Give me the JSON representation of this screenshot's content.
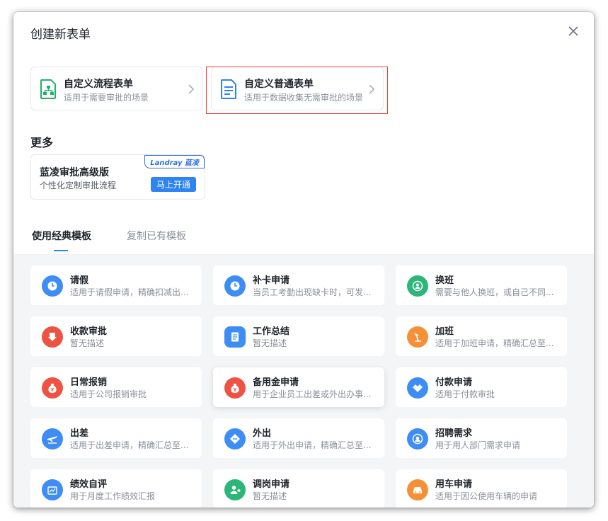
{
  "dialog": {
    "title": "创建新表单"
  },
  "types": [
    {
      "name": "自定义流程表单",
      "desc": "适用于需要审批的场景"
    },
    {
      "name": "自定义普通表单",
      "desc": "适用于数据收集无需审批的场景"
    }
  ],
  "more": {
    "heading": "更多",
    "promo_title": "蓝凌审批高级版",
    "promo_desc": "个性化定制审批流程",
    "brand": "Landray 蓝凌",
    "button": "马上开通"
  },
  "tabs": [
    "使用经典模板",
    "复制已有模板"
  ],
  "templates": [
    {
      "name": "请假",
      "desc": "适用于请假申请，精确扣减出...",
      "color": "#3d8df5",
      "icon": "clock-icon"
    },
    {
      "name": "补卡申请",
      "desc": "当员工考勤出现缺卡时，可发...",
      "color": "#3d8df5",
      "icon": "clock-icon"
    },
    {
      "name": "换班",
      "desc": "需要与他人换班，或自己不同...",
      "color": "#2cb679",
      "icon": "swap-user-icon"
    },
    {
      "name": "收款审批",
      "desc": "暂无描述",
      "color": "#ee5243",
      "icon": "receive-icon"
    },
    {
      "name": "工作总结",
      "desc": "暂无描述",
      "color": "#3d8df5",
      "icon": "document-icon"
    },
    {
      "name": "加班",
      "desc": "适用于加班申请，精确汇总至...",
      "color": "#f59037",
      "icon": "desk-lamp-icon"
    },
    {
      "name": "日常报销",
      "desc": "适用于公司报销审批",
      "color": "#ee5243",
      "icon": "money-bag-icon"
    },
    {
      "name": "备用金申请",
      "desc": "用于企业员工出差或外出办事...",
      "color": "#ee5243",
      "icon": "money-bag-icon"
    },
    {
      "name": "付款申请",
      "desc": "适用于付款审批",
      "color": "#3d8df5",
      "icon": "handshake-icon"
    },
    {
      "name": "出差",
      "desc": "适用于出差申请，精确汇总至...",
      "color": "#3d8df5",
      "icon": "plane-icon"
    },
    {
      "name": "外出",
      "desc": "适用于外出申请，精确汇总至...",
      "color": "#3d8df5",
      "icon": "outing-icon"
    },
    {
      "name": "招聘需求",
      "desc": "用于用人部门需求申请",
      "color": "#3d8df5",
      "icon": "recruit-icon"
    },
    {
      "name": "绩效自评",
      "desc": "用于月度工作绩效汇报",
      "color": "#3d8df5",
      "icon": "chart-icon"
    },
    {
      "name": "调岗申请",
      "desc": "暂无描述",
      "color": "#2cb679",
      "icon": "transfer-user-icon"
    },
    {
      "name": "用车申请",
      "desc": "适用于因公使用车辆的申请",
      "color": "#f59037",
      "icon": "car-icon"
    }
  ]
}
